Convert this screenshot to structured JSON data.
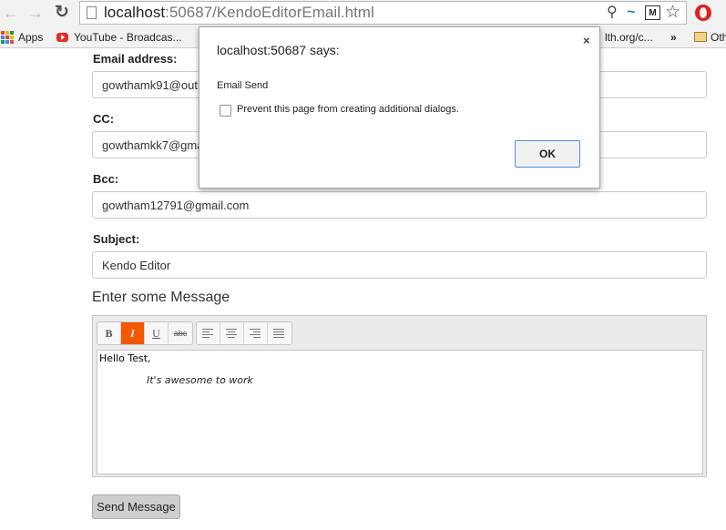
{
  "browser": {
    "url_host": "localhost",
    "url_path": ":50687/KendoEditorEmail.html",
    "icons": [
      "back-icon",
      "forward-icon",
      "reload-icon",
      "page-icon",
      "zoom-icon",
      "extension-icon",
      "star-icon",
      "opera-icon"
    ]
  },
  "bookmarks": {
    "apps": "Apps",
    "youtube": "YouTube - Broadcas...",
    "truncated": "lth.org/c...",
    "more": "»",
    "other": "Oth",
    "apps_colors": [
      "#e04a3f",
      "#f4b400",
      "#0f9d58",
      "#4285f4",
      "#db4437",
      "#f4b400",
      "#0f9d58",
      "#4285f4",
      "#e04a3f"
    ]
  },
  "form": {
    "email_label": "Email address:",
    "email_value": "gowthamk91@outlook.com",
    "cc_label": "CC:",
    "cc_value": "gowthamkk7@gmail.com",
    "bcc_label": "Bcc:",
    "bcc_value": "gowtham12791@gmail.com",
    "subject_label": "Subject:",
    "subject_value": "Kendo Editor"
  },
  "editor": {
    "heading": "Enter some Message",
    "tools": {
      "bold": "B",
      "italic": "I",
      "underline": "U",
      "strike": "abc"
    },
    "active_color": "#f35800",
    "line1": "Hello Test,",
    "line2": "It's awesome to work"
  },
  "send_label": "Send Message",
  "dialog": {
    "title": "localhost:50687 says:",
    "close": "×",
    "message": "Email Send",
    "checkbox_label": "Prevent this page from creating additional dialogs.",
    "ok": "OK"
  }
}
